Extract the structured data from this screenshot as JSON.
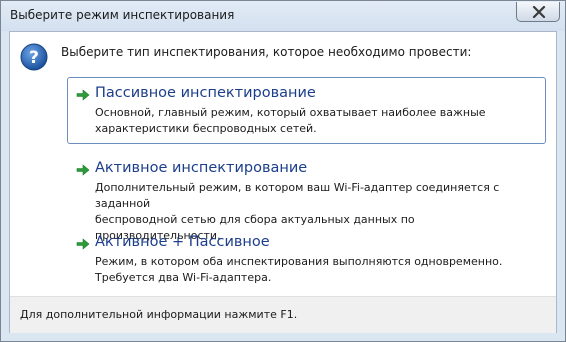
{
  "window": {
    "title": "Выберите режим инспектирования"
  },
  "dialog": {
    "question": "Выберите тип инспектирования, которое необходимо провести:",
    "options": [
      {
        "title": "Пассивное инспектирование",
        "description_line1": "Основной, главный режим, который охватывает наиболее важные",
        "description_line2": "характеристики беспроводных сетей."
      },
      {
        "title": "Активное инспектирование",
        "description_line1": "Дополнительный режим, в котором ваш Wi-Fi-адаптер соединяется с заданной",
        "description_line2": "беспроводной сетью для сбора актуальных данных по производительности."
      },
      {
        "title": "Активное + Пассивное",
        "description_line1": "Режим, в котором оба инспектирования выполняются одновременно.",
        "description_line2": "Требуется два Wi-Fi-адаптера."
      }
    ],
    "footer": "Для дополнительной информации нажмите F1."
  },
  "icons": {
    "help": "question-icon",
    "option_arrow": "green-arrow-icon",
    "close": "close-icon"
  },
  "colors": {
    "option_title": "#1c3e8b",
    "arrow": "#2e9b3a",
    "help_icon": "#1e5ba8"
  }
}
